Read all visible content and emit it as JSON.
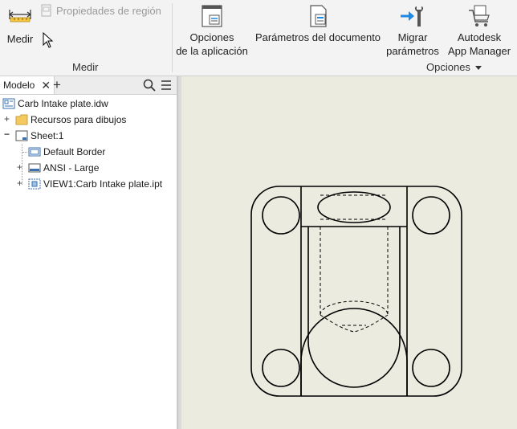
{
  "ribbon": {
    "measure_label": "Medir",
    "region_properties_label": "Propiedades de región",
    "measure_panel_title": "Medir",
    "app_options_line1": "Opciones",
    "app_options_line2": "de la aplicación",
    "doc_settings_label": "Parámetros del documento",
    "migrate_line1": "Migrar",
    "migrate_line2": "parámetros",
    "autodesk_line1": "Autodesk",
    "autodesk_line2": "App Manager",
    "options_panel_title": "Opciones"
  },
  "browser": {
    "tab_label": "Modelo",
    "tree": [
      {
        "label": "Carb Intake plate.idw"
      },
      {
        "label": "Recursos para dibujos"
      },
      {
        "label": "Sheet:1"
      },
      {
        "label": "Default Border"
      },
      {
        "label": "ANSI - Large"
      },
      {
        "label": "VIEW1:Carb Intake plate.ipt"
      }
    ]
  },
  "colors": {
    "canvas_bg": "#ebecdf",
    "accent_blue": "#1e88e5"
  }
}
